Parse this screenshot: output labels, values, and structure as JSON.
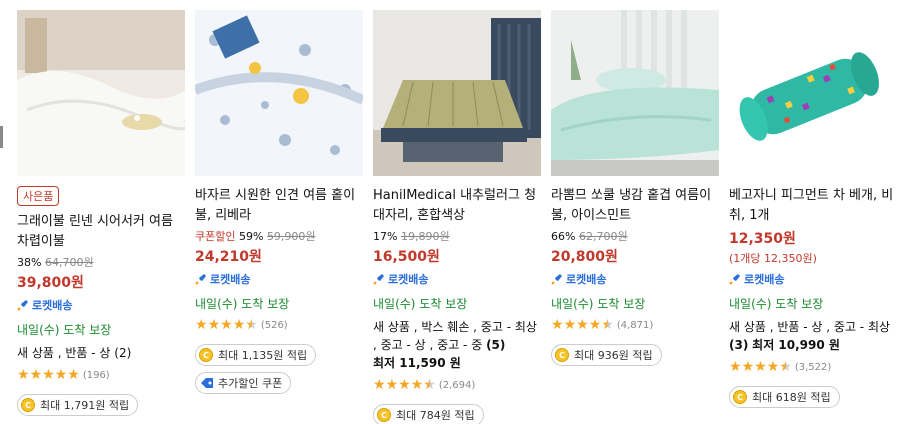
{
  "products": [
    {
      "badge": "사은품",
      "title": "그래이불 린넨 시어서커 여름 차렵이불",
      "discount": "38%",
      "original_price": "64,700원",
      "price": "39,800원",
      "rocket": "로켓배송",
      "delivery": "내일(수) 도착 보장",
      "condition": "새 상품 , 반품 - 상 (2)",
      "rating": 5,
      "review_count": "(196)",
      "reward": "최대 1,791원 적립"
    },
    {
      "title": "바자르 시원한 인견 여름 홑이불, 리베라",
      "coupon_label": "쿠폰할인",
      "discount": "59%",
      "original_price": "59,900원",
      "price": "24,210원",
      "rocket": "로켓배송",
      "delivery": "내일(수) 도착 보장",
      "rating": 4.5,
      "review_count": "(526)",
      "reward": "최대 1,135원 적립",
      "extra_coupon": "추가할인 쿠폰"
    },
    {
      "title": "HanilMedical 내추럴러그 청대자리, 혼합색상",
      "discount": "17%",
      "original_price": "19,890원",
      "price": "16,500원",
      "rocket": "로켓배송",
      "delivery": "내일(수) 도착 보장",
      "condition_text": "새 상품 , 박스 훼손 , 중고 - 최상 , 중고 - 상 , 중고 - 중",
      "condition_count": "(5)",
      "condition_min": "최저 11,590 원",
      "rating": 4.5,
      "review_count": "(2,694)",
      "reward": "최대 784원 적립"
    },
    {
      "title": "라뽐므 쏘쿨 냉감 홑겹 여름이불, 아이스민트",
      "discount": "66%",
      "original_price": "62,700원",
      "price": "20,800원",
      "rocket": "로켓배송",
      "delivery": "내일(수) 도착 보장",
      "rating": 4.5,
      "review_count": "(4,871)",
      "reward": "최대 936원 적립"
    },
    {
      "title": "베고자니 피그먼트 차 베개, 비취, 1개",
      "price": "12,350원",
      "unit_price": "(1개당 12,350원)",
      "rocket": "로켓배송",
      "delivery": "내일(수) 도착 보장",
      "condition_text": "새 상품 , 반품 - 상 , 중고 - 최상",
      "condition_count": "(3)",
      "condition_min": "최저 10,990 원",
      "rating": 4.5,
      "review_count": "(3,522)",
      "reward": "최대 618원 적립"
    }
  ],
  "colors": {
    "price": "#c0392b",
    "rocket": "#2b6fdb",
    "delivery": "#1a8a2e",
    "star": "#f5a623"
  }
}
